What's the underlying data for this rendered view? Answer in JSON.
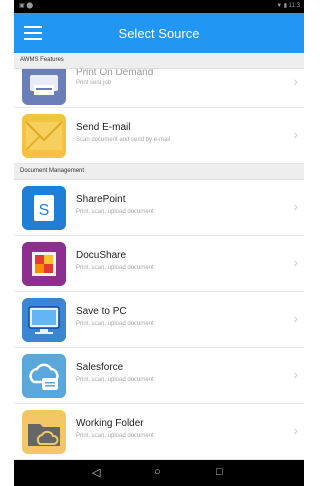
{
  "status": {
    "left": "▣ ⬤",
    "right": "▼ ▮ 11:3"
  },
  "appbar": {
    "title": "Select Source"
  },
  "sections": [
    {
      "label": "AWMS Features",
      "items": [
        {
          "name": "Print On Demand",
          "desc": "Print sent job",
          "icon": "print-on-demand-icon"
        },
        {
          "name": "Send E-mail",
          "desc": "Scan document and send by e-mail",
          "icon": "email-icon"
        }
      ]
    },
    {
      "label": "Document Management",
      "items": [
        {
          "name": "SharePoint",
          "desc": "Print, scan, upload document",
          "icon": "sharepoint-icon"
        },
        {
          "name": "DocuShare",
          "desc": "Print, scan, upload document",
          "icon": "docushare-icon"
        },
        {
          "name": "Save to PC",
          "desc": "Print, scan, upload document",
          "icon": "save-to-pc-icon"
        },
        {
          "name": "Salesforce",
          "desc": "Print, scan, upload document",
          "icon": "salesforce-icon"
        },
        {
          "name": "Working Folder",
          "desc": "Print, scan, upload document",
          "icon": "working-folder-icon"
        }
      ]
    }
  ],
  "navbar": {
    "back": "◁",
    "home": "○",
    "recent": "□"
  }
}
